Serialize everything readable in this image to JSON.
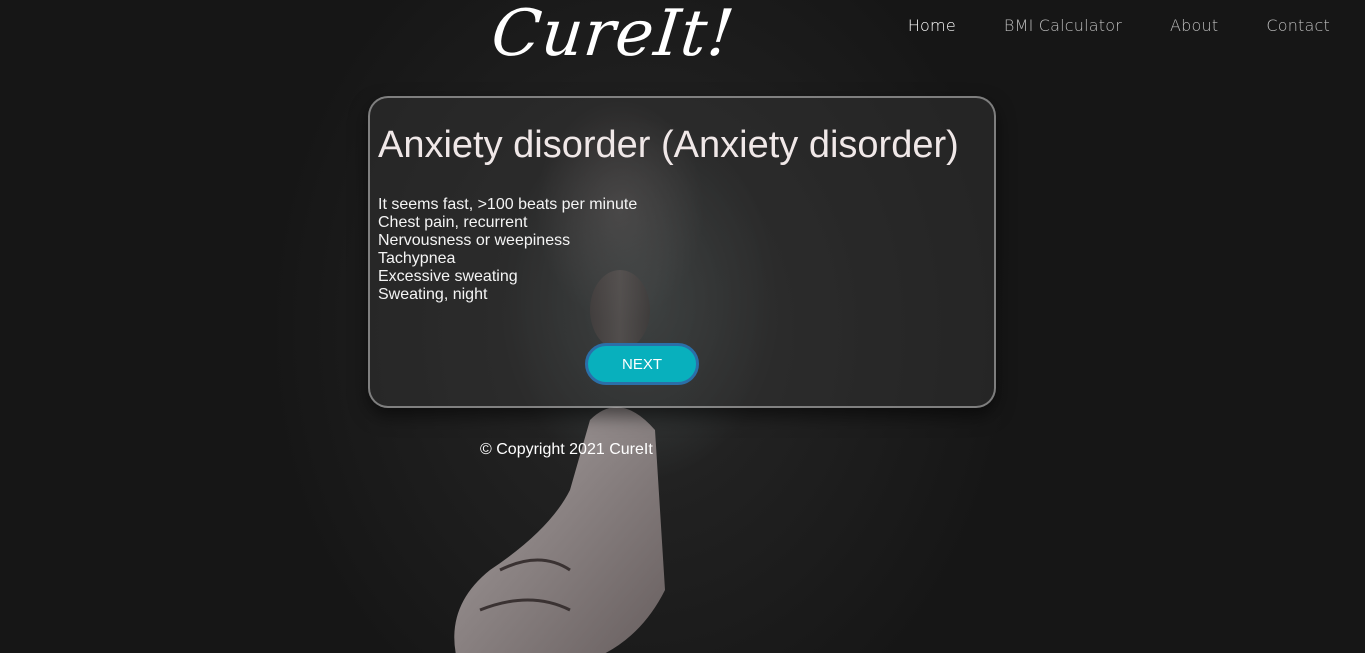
{
  "header": {
    "logo": "CureIt!",
    "nav": [
      {
        "label": "Home"
      },
      {
        "label": "BMI Calculator"
      },
      {
        "label": "About"
      },
      {
        "label": "Contact"
      }
    ]
  },
  "result": {
    "title": "Anxiety disorder (Anxiety disorder)",
    "symptoms": [
      "It seems fast, >100 beats per minute",
      "Chest pain, recurrent",
      "Nervousness or weepiness",
      "Tachypnea",
      "Excessive sweating",
      "Sweating, night"
    ],
    "next_label": "NEXT"
  },
  "footer": {
    "copyright": "© Copyright 2021 CureIt"
  },
  "colors": {
    "accent": "#08b0bd",
    "background": "#1c1c1c"
  }
}
